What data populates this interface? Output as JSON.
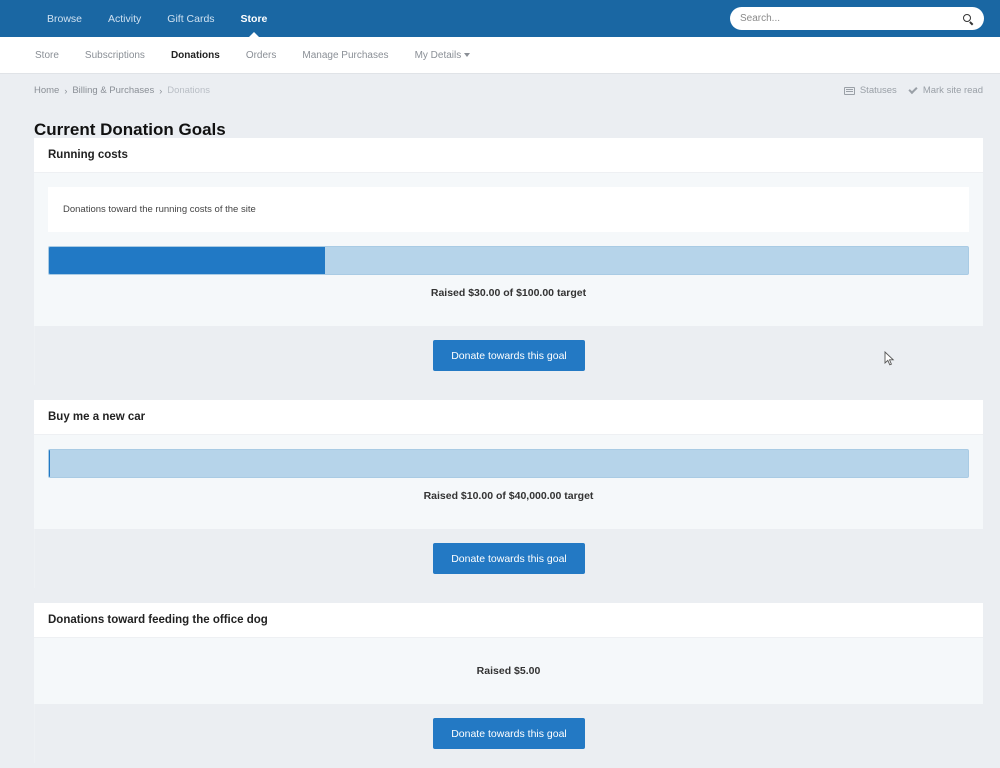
{
  "topnav": {
    "items": [
      {
        "label": "Browse",
        "active": false
      },
      {
        "label": "Activity",
        "active": false
      },
      {
        "label": "Gift Cards",
        "active": false
      },
      {
        "label": "Store",
        "active": true
      }
    ],
    "search": {
      "placeholder": "Search...",
      "value": "",
      "icon": "search-icon"
    }
  },
  "subnav": {
    "items": [
      {
        "label": "Store",
        "active": false
      },
      {
        "label": "Subscriptions",
        "active": false
      },
      {
        "label": "Donations",
        "active": true
      },
      {
        "label": "Orders",
        "active": false
      },
      {
        "label": "Manage Purchases",
        "active": false
      },
      {
        "label": "My Details",
        "active": false,
        "dropdown": true
      }
    ]
  },
  "breadcrumb": {
    "items": [
      "Home",
      "Billing & Purchases",
      "Donations"
    ],
    "separator": "›"
  },
  "actions": {
    "statuses": {
      "label": "Statuses",
      "icon": "statuses-icon"
    },
    "mark_read": {
      "label": "Mark site read",
      "icon": "check-icon"
    }
  },
  "page": {
    "title": "Current Donation Goals"
  },
  "goals": [
    {
      "title": "Running costs",
      "description": "Donations toward the running costs of the site",
      "raised": 30.0,
      "target": 100.0,
      "progress_percent": 30,
      "raised_text": "Raised $30.00 of $100.00 target",
      "button_label": "Donate towards this goal"
    },
    {
      "title": "Buy me a new car",
      "raised": 10.0,
      "target": 40000.0,
      "progress_percent": 0.025,
      "raised_text": "Raised $10.00 of $40,000.00 target",
      "button_label": "Donate towards this goal"
    },
    {
      "title": "Donations toward feeding the office dog",
      "raised": 5.0,
      "raised_text": "Raised $5.00",
      "button_label": "Donate towards this goal"
    }
  ],
  "colors": {
    "brand": "#1a67a3",
    "button": "#2379c4",
    "progress_fill": "#2179c5",
    "progress_track": "#b6d4ea",
    "background": "#ebeef2"
  }
}
